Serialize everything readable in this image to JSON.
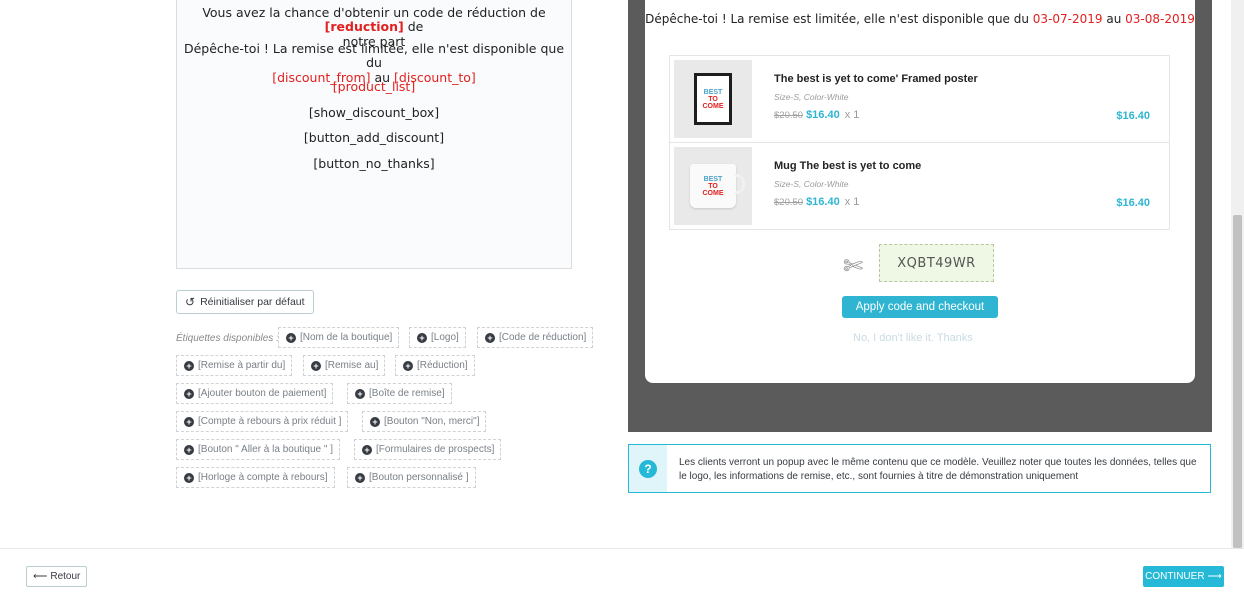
{
  "editor": {
    "line1_pre": "Vous avez la chance d'obtenir un code de réduction de ",
    "line1_tag": "[reduction]",
    "line1_post": " de",
    "line1_cont": "notre part",
    "line2": "Dépêche-toi ! La remise est limitée, elle n'est disponible que du",
    "from_tag": "[discount_from]",
    "au": " au ",
    "to_tag": "[discount_to]",
    "product_list": "[product_list]",
    "show_discount_box": "[show_discount_box]",
    "button_add_discount": "[button_add_discount]",
    "button_no_thanks": "[button_no_thanks]"
  },
  "reset_button": {
    "icon": "undo-icon",
    "label": "Réinitialiser par défaut"
  },
  "tags_label": "Étiquettes disponibles :",
  "tags": [
    "[Nom de la boutique]",
    "[Logo]",
    "[Code de réduction]",
    "[Remise à partir du]",
    "[Remise au]",
    "[Réduction]",
    "[Ajouter bouton de paiement]",
    "[Boîte de remise]",
    "[Compte à rebours à prix réduit ]",
    "[Bouton \"Non, merci\"]",
    "[Bouton \" Aller à la boutique \" ]",
    "[Formulaires de prospects]",
    "[Horloge à compte à rebours]",
    "[Bouton personnalisé ]"
  ],
  "popup": {
    "headline_pre": "Dépêche-toi ! La remise est limitée, elle n'est disponible que du ",
    "date_from": "03-07-2019",
    "au": " au ",
    "date_to": "03-08-2019",
    "products": [
      {
        "name": "The best is yet to come' Framed poster",
        "attributes": "Size-S, Color-White",
        "old_price": "$20.50",
        "new_price": "$16.40",
        "qty": "x 1",
        "total": "$16.40",
        "image": "framed-poster"
      },
      {
        "name": "Mug The best is yet to come",
        "attributes": "Size-S, Color-White",
        "old_price": "$20.50",
        "new_price": "$16.40",
        "qty": "x 1",
        "total": "$16.40",
        "image": "mug"
      }
    ],
    "product_art": {
      "line1": "BEST",
      "line2": "TO",
      "line3": "COME"
    },
    "scissors_icon": "scissors-icon",
    "discount_code": "XQBT49WR",
    "apply_button": "Apply code and checkout",
    "no_thanks": "No, I don't like it. Thanks"
  },
  "info": {
    "icon": "question-icon",
    "message": "Les clients verront un popup avec le même contenu que ce modèle. Veuillez noter que toutes les données, telles que le logo, les informations de remise, etc., sont fournies à titre de démonstration uniquement"
  },
  "footer": {
    "back_label": "Retour",
    "continue_label": "CONTINUER"
  },
  "colors": {
    "accent": "#25b9d7",
    "price": "#2fb5d2",
    "tag_red": "#e2201f",
    "preview_bg": "#5b5b5b"
  }
}
